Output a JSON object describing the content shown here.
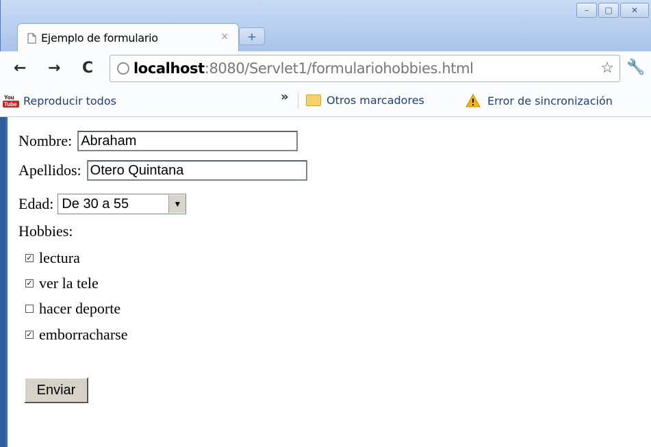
{
  "window": {
    "minimize_icon": "minimize-icon",
    "maximize_icon": "maximize-icon",
    "close_icon": "close-icon"
  },
  "tabs": [
    {
      "title": "Ejemplo de formulario",
      "icon": "page-icon"
    }
  ],
  "toolbar": {
    "url_host": "localhost",
    "url_rest": ":8080/Servlet1/formulariohobbies.html"
  },
  "bookmarks": {
    "youtube_label": "Reproducir todos",
    "other_label": "Otros marcadores",
    "sync_error_label": "Error de sincronización"
  },
  "form": {
    "nombre_label": "Nombre:",
    "nombre_value": "Abraham",
    "apellidos_label": "Apellidos:",
    "apellidos_value": "Otero Quintana",
    "edad_label": "Edad:",
    "edad_value": "De 30 a 55",
    "hobbies_label": "Hobbies:",
    "hobbies": [
      {
        "label": " lectura",
        "checked": true
      },
      {
        "label": "ver la tele",
        "checked": true
      },
      {
        "label": "hacer deporte",
        "checked": false
      },
      {
        "label": "emborracharse",
        "checked": true
      }
    ],
    "submit_label": "Enviar"
  }
}
